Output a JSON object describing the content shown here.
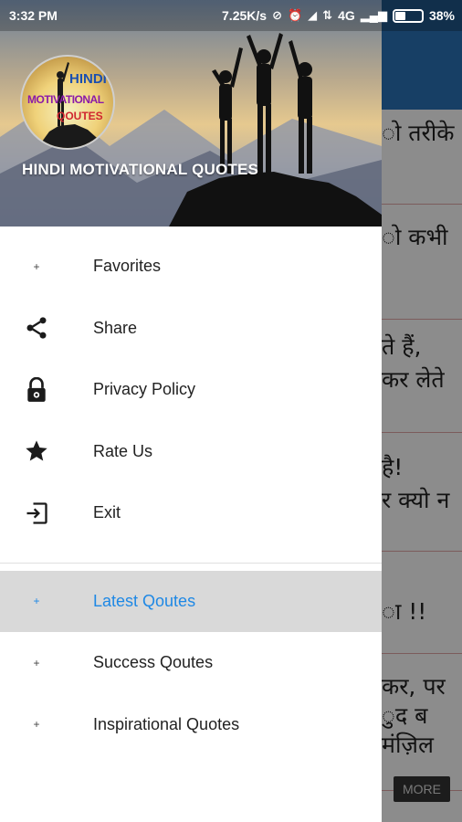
{
  "status_bar": {
    "time": "3:32 PM",
    "net_speed": "7.25K/s",
    "network": "4G",
    "battery": "38%",
    "battery_level": 0.38
  },
  "background": {
    "snippets": [
      "ो तरीके",
      "ो कभी",
      "ते हैं,",
      "कर लेते",
      "है!",
      "र क्यो न",
      "ा !!",
      "कर, पर",
      "ुद ब",
      "मंज़िल"
    ],
    "more_label": "MORE"
  },
  "drawer": {
    "logo": {
      "line1": "HINDI",
      "line2": "MOTIVATIONAL",
      "line3": "QOUTES"
    },
    "header_title": "HINDI MOTIVATIONAL QUOTES",
    "primary_items": [
      {
        "label": "Favorites",
        "icon": "plus-icon"
      },
      {
        "label": "Share",
        "icon": "share-icon"
      },
      {
        "label": "Privacy Policy",
        "icon": "lock-icon"
      },
      {
        "label": "Rate Us",
        "icon": "star-icon"
      },
      {
        "label": "Exit",
        "icon": "exit-icon"
      }
    ],
    "category_items": [
      {
        "label": "Latest Qoutes",
        "icon": "plus-icon",
        "active": true
      },
      {
        "label": "Success Qoutes",
        "icon": "plus-icon",
        "active": false
      },
      {
        "label": "Inspirational Quotes",
        "icon": "plus-icon",
        "active": false
      }
    ]
  },
  "colors": {
    "accent": "#1e88e5",
    "toolbar": "#2a73b8",
    "active_row": "#d9d9d9"
  }
}
